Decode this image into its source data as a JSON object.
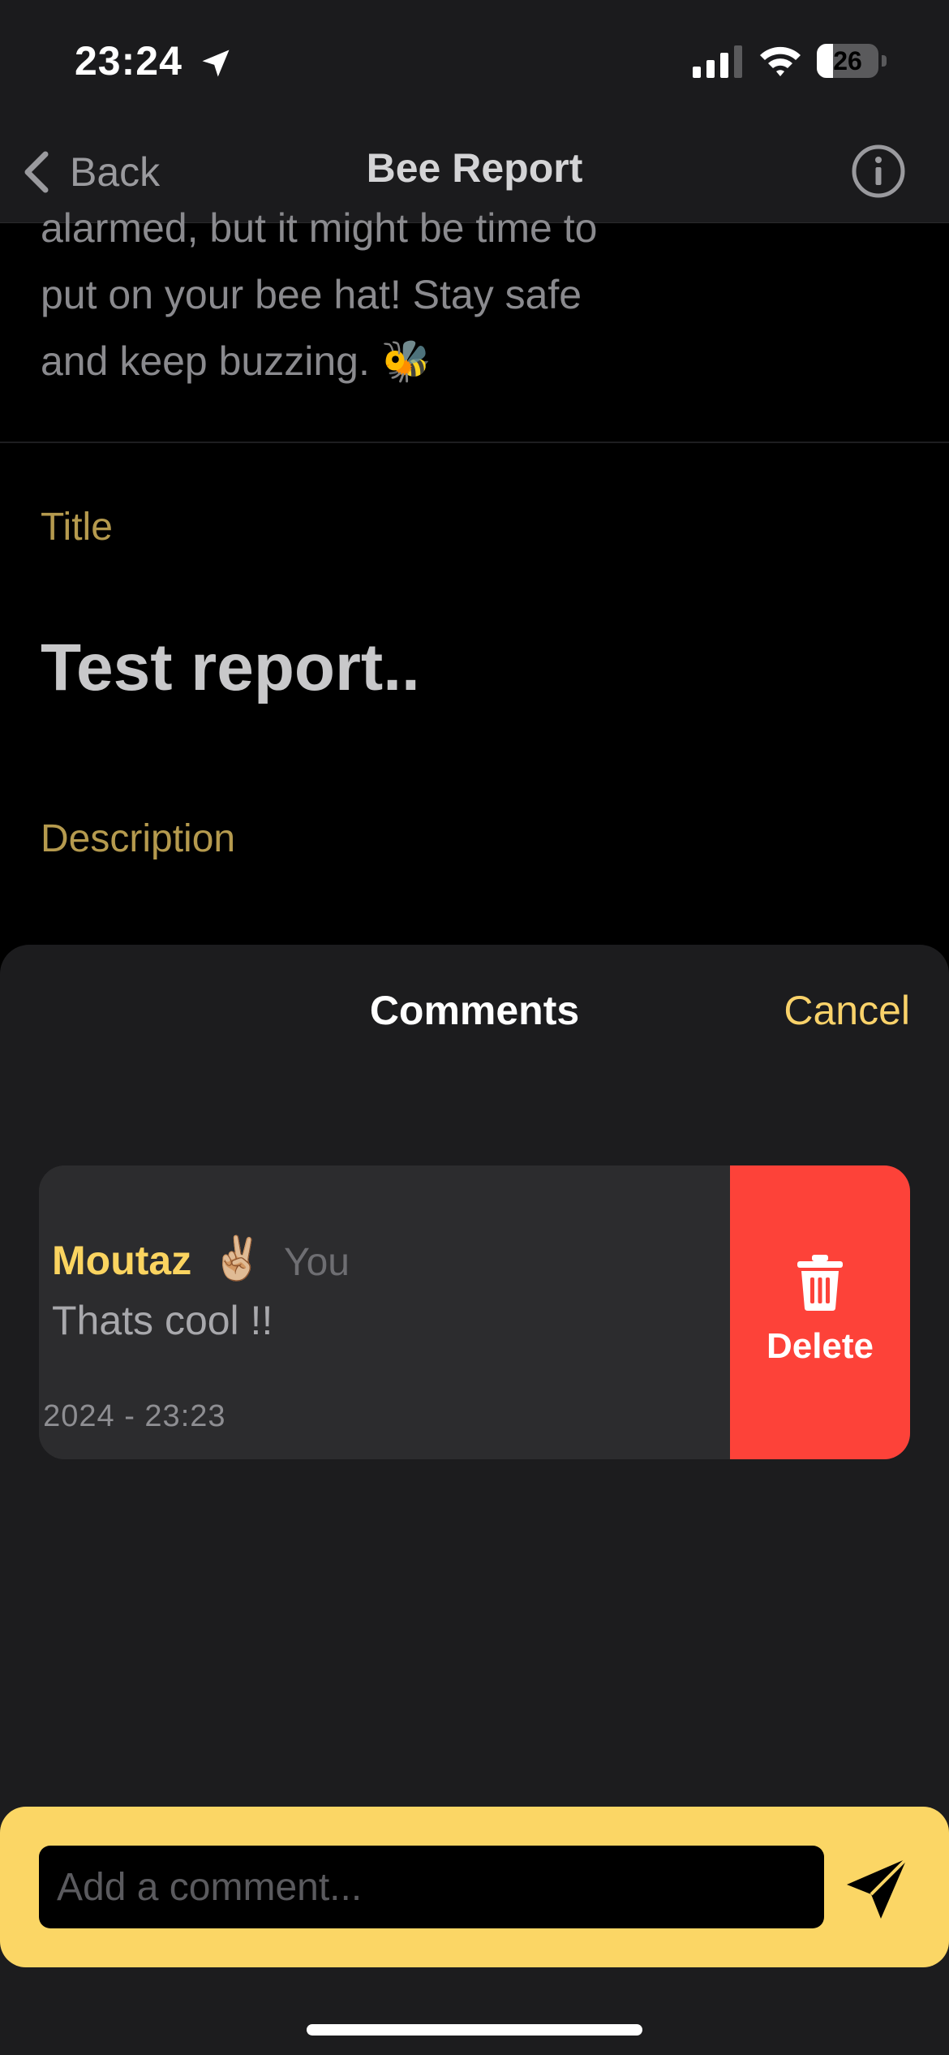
{
  "status_bar": {
    "time": "23:24",
    "battery_level": "26",
    "battery_fraction": 0.26,
    "location_icon": "location-arrow-icon",
    "signal_icon": "cellular-signal-icon",
    "wifi_icon": "wifi-icon",
    "battery_icon": "battery-icon"
  },
  "nav": {
    "back_label": "Back",
    "title": "Bee Report",
    "back_icon": "chevron-left-icon",
    "info_icon": "info-circle-icon"
  },
  "report": {
    "body_lines": [
      "alarmed, but it might be time to",
      "put on your bee hat! Stay safe",
      "and keep buzzing. 🐝"
    ],
    "title_label": "Title",
    "title_value": "Test report..",
    "description_label": "Description"
  },
  "comments_sheet": {
    "title": "Comments",
    "cancel_label": "Cancel",
    "comments": [
      {
        "author": "Moutaz",
        "author_emoji": "✌🏼",
        "you_label": "You",
        "text": "Thats cool !!",
        "date": "t 2024 - 23:23",
        "delete_label": "Delete",
        "delete_icon": "trash-icon"
      }
    ]
  },
  "composer": {
    "placeholder": "Add a comment...",
    "value": "",
    "send_icon": "send-icon"
  },
  "colors": {
    "accent_yellow": "#fbd460",
    "label_gold": "#b59a4e",
    "delete_red": "#fd4239",
    "sheet_bg": "#1c1c1e",
    "composer_bg": "#fbd665"
  }
}
